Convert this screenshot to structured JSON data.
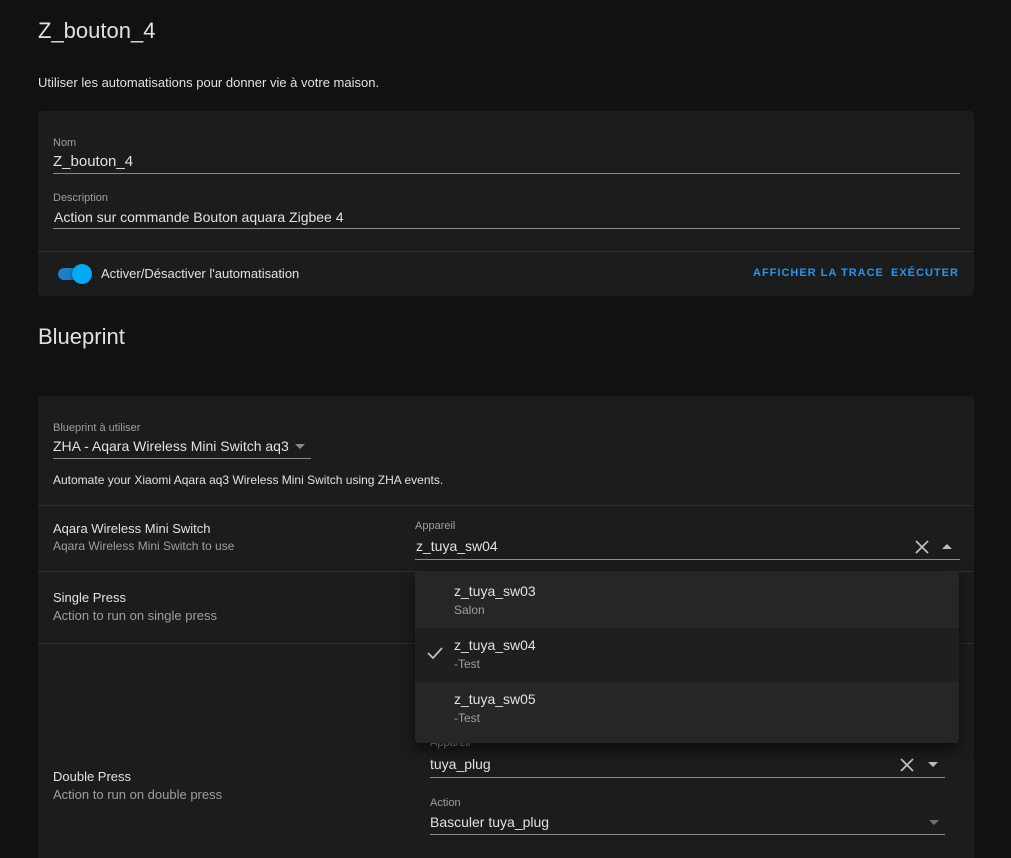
{
  "header": {
    "title": "Z_bouton_4",
    "subtitle": "Utiliser les automatisations pour donner vie à votre maison."
  },
  "details_card": {
    "name_label": "Nom",
    "name_value": "Z_bouton_4",
    "description_label": "Description",
    "description_value": "Action sur commande Bouton aquara Zigbee 4",
    "toggle_label": "Activer/Désactiver l'automatisation",
    "toggle_on": true,
    "trace_button": "AFFICHER LA TRACE",
    "run_button": "EXÉCUTER"
  },
  "blueprint_section": {
    "title": "Blueprint",
    "blueprint_label": "Blueprint à utiliser",
    "blueprint_value": "ZHA - Aqara Wireless Mini Switch aq3",
    "blueprint_description": "Automate your Xiaomi Aqara aq3 Wireless Mini Switch using ZHA events.",
    "inputs": [
      {
        "title": "Aqara Wireless Mini Switch",
        "description": "Aqara Wireless Mini Switch to use",
        "device_label": "Appareil",
        "device_value": "z_tuya_sw04"
      },
      {
        "title": "Single Press",
        "description": "Action to run on single press"
      },
      {
        "title": "Double Press",
        "description": "Action to run on double press",
        "device_label": "Appareil",
        "device_value": "tuya_plug",
        "action_label": "Action",
        "action_value": "Basculer tuya_plug"
      }
    ]
  },
  "device_dropdown": {
    "options": [
      {
        "name": "z_tuya_sw03",
        "area": "Salon",
        "selected": false
      },
      {
        "name": "z_tuya_sw04",
        "area": "-Test",
        "selected": true
      },
      {
        "name": "z_tuya_sw05",
        "area": "-Test",
        "selected": false
      }
    ]
  },
  "colors": {
    "accent": "#03a9f4",
    "link": "#2196f3",
    "background": "#111111",
    "card": "#1c1c1c"
  }
}
